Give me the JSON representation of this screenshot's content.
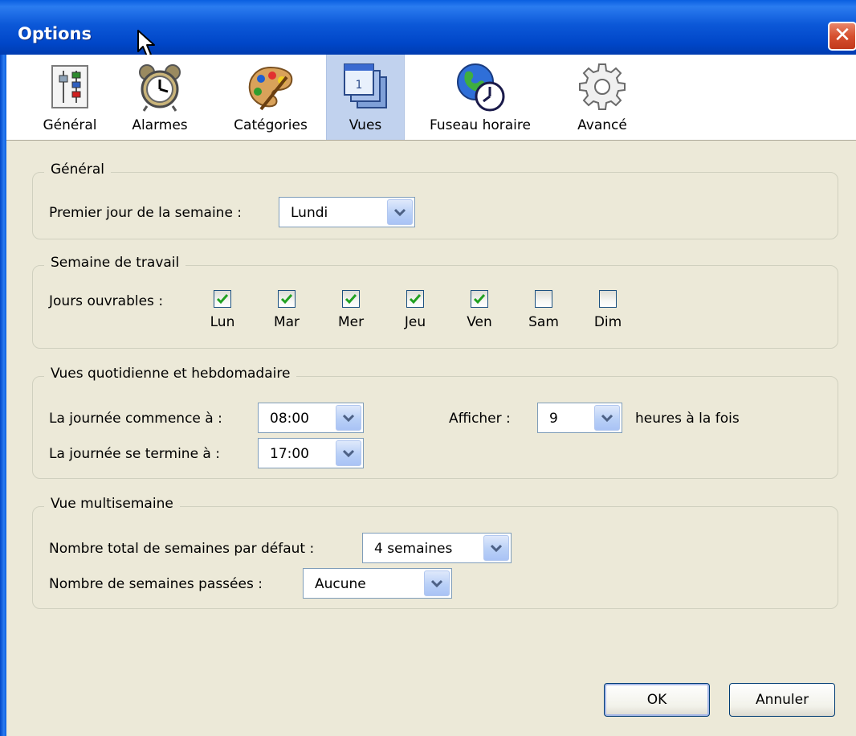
{
  "window": {
    "title": "Options",
    "close_icon": "close-icon"
  },
  "tabs": [
    {
      "label": "Général",
      "icon": "sliders-icon"
    },
    {
      "label": "Alarmes",
      "icon": "alarm-clock-icon"
    },
    {
      "label": "Catégories",
      "icon": "palette-icon"
    },
    {
      "label": "Vues",
      "icon": "calendar-views-icon"
    },
    {
      "label": "Fuseau horaire",
      "icon": "globe-clock-icon"
    },
    {
      "label": "Avancé",
      "icon": "gear-icon"
    }
  ],
  "selected_tab": "Vues",
  "general": {
    "legend": "Général",
    "first_day_label": "Premier jour de la semaine :",
    "first_day_value": "Lundi"
  },
  "workweek": {
    "legend": "Semaine de travail",
    "days_label": "Jours ouvrables :",
    "days": [
      {
        "label": "Lun",
        "checked": true
      },
      {
        "label": "Mar",
        "checked": true
      },
      {
        "label": "Mer",
        "checked": true
      },
      {
        "label": "Jeu",
        "checked": true
      },
      {
        "label": "Ven",
        "checked": true
      },
      {
        "label": "Sam",
        "checked": false
      },
      {
        "label": "Dim",
        "checked": false
      }
    ]
  },
  "dayweek": {
    "legend": "Vues quotidienne et hebdomadaire",
    "start_label": "La journée commence à :",
    "start_value": "08:00",
    "end_label": "La journée se termine à :",
    "end_value": "17:00",
    "show_label": "Afficher :",
    "show_value": "9",
    "show_suffix": "heures à la fois"
  },
  "multiweek": {
    "legend": "Vue multisemaine",
    "total_label": "Nombre total de semaines par défaut :",
    "total_value": "4 semaines",
    "past_label": "Nombre de semaines passées :",
    "past_value": "Aucune"
  },
  "buttons": {
    "ok": "OK",
    "cancel": "Annuler"
  },
  "colors": {
    "title_blue": "#0054e3",
    "selected_tab": "#c1d2ee",
    "check_green": "#21a121",
    "close_red": "#d6502f"
  }
}
